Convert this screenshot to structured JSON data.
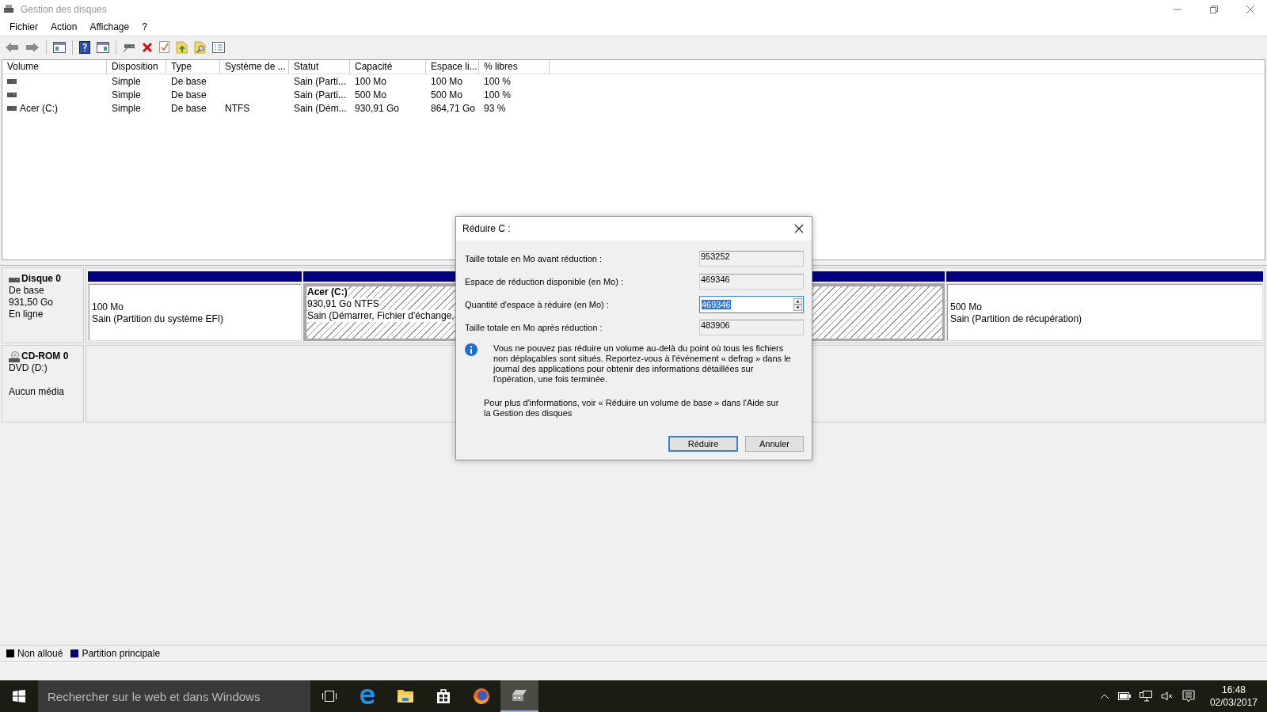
{
  "window": {
    "title": "Gestion des disques"
  },
  "menu": [
    "Fichier",
    "Action",
    "Affichage",
    "?"
  ],
  "volumes_table": {
    "columns": [
      "Volume",
      "Disposition",
      "Type",
      "Système de ...",
      "Statut",
      "Capacité",
      "Espace li...",
      "% libres"
    ],
    "rows": [
      {
        "disposition": "Simple",
        "type": "De base",
        "status": "Sain (Parti...",
        "capacity": "100 Mo",
        "free_space": "100 Mo",
        "percent_free": "100 %"
      },
      {
        "disposition": "Simple",
        "type": "De base",
        "status": "Sain (Parti...",
        "capacity": "500 Mo",
        "free_space": "500 Mo",
        "percent_free": "100 %"
      },
      {
        "volume": "Acer (C:)",
        "disposition": "Simple",
        "type": "De base",
        "file_system": "NTFS",
        "status": "Sain (Dém...",
        "capacity": "930,91 Go",
        "free_space": "864,71 Go",
        "percent_free": "93 %"
      }
    ]
  },
  "disks": [
    {
      "kind": "disk",
      "name": "Disque 0",
      "type": "De base",
      "size": "931,50 Go",
      "status": "En ligne",
      "partitions": [
        {
          "size": "100 Mo",
          "status": "Sain (Partition du système EFI)",
          "selected": false
        },
        {
          "label": "Acer  (C:)",
          "size": "930,91 Go NTFS",
          "status": "Sain (Démarrer, Fichier d'échange,",
          "selected": true
        },
        {
          "size": "500 Mo",
          "status": "Sain (Partition de récupération)",
          "selected": false
        }
      ]
    },
    {
      "kind": "cdrom",
      "name": "CD-ROM 0",
      "type": "DVD (D:)",
      "status": "Aucun média"
    }
  ],
  "legend": [
    {
      "label": "Non alloué",
      "color": "#000000"
    },
    {
      "label": "Partition principale",
      "color": "#000080"
    }
  ],
  "dialog": {
    "title": "Réduire C :",
    "fields": [
      {
        "kind": "readonly",
        "label": "Taille totale en Mo avant réduction :",
        "value": "953252"
      },
      {
        "kind": "readonly",
        "label": "Espace de réduction disponible (en Mo) :",
        "value": "469346"
      },
      {
        "kind": "spinner",
        "label": "Quantité d'espace à réduire (en Mo) :",
        "value": "469346"
      },
      {
        "kind": "readonly",
        "label": "Taille totale en Mo après réduction :",
        "value": "483906"
      }
    ],
    "info": "Vous ne pouvez pas réduire un volume au-delà du point où tous les fichiers non déplaçables sont situés. Reportez-vous à l'événement « defrag » dans le journal des applications pour obtenir des informations détaillées sur l'opération, une fois terminée.",
    "more_info": "Pour plus d'informations, voir « Réduire un volume de base » dans l'Aide sur la Gestion des disques",
    "buttons": [
      {
        "label": "Réduire",
        "default": true
      },
      {
        "label": "Annuler",
        "default": false
      }
    ]
  },
  "taskbar": {
    "search_placeholder": "Rechercher sur le web et dans Windows",
    "apps": [
      {
        "kind": "taskview",
        "selected": false
      },
      {
        "kind": "browser",
        "selected": false
      },
      {
        "kind": "folder",
        "selected": false
      },
      {
        "kind": "store",
        "selected": false
      },
      {
        "kind": "fox",
        "selected": false
      },
      {
        "kind": "disk",
        "selected": true
      }
    ],
    "time": "16:48",
    "date": "02/03/2017"
  }
}
